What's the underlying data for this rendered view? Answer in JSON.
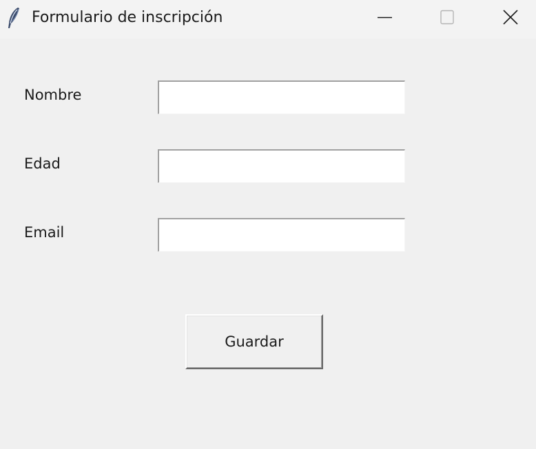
{
  "window": {
    "title": "Formulario de inscripción",
    "app_icon": "feather-icon",
    "controls": {
      "minimize_icon": "minimize-icon",
      "maximize_icon": "maximize-icon",
      "close_icon": "close-icon"
    }
  },
  "form": {
    "fields": [
      {
        "label": "Nombre",
        "value": ""
      },
      {
        "label": "Edad",
        "value": ""
      },
      {
        "label": "Email",
        "value": ""
      }
    ],
    "save_label": "Guardar"
  },
  "colors": {
    "background": "#f0f0f0",
    "titlebar": "#f3f3f3",
    "input_background": "#ffffff",
    "text": "#1a1a1a"
  }
}
